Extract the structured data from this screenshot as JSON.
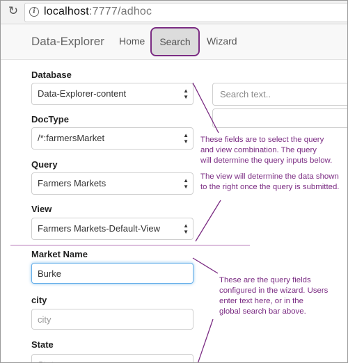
{
  "browser": {
    "url_host": "localhost",
    "url_rest": ":7777/adhoc"
  },
  "navbar": {
    "brand": "Data-Explorer",
    "links": [
      "Home",
      "Search",
      "Wizard"
    ],
    "active": "Search"
  },
  "form": {
    "database": {
      "label": "Database",
      "value": "Data-Explorer-content"
    },
    "doctype": {
      "label": "DocType",
      "value": "/*:farmersMarket"
    },
    "query": {
      "label": "Query",
      "value": "Farmers Markets"
    },
    "view": {
      "label": "View",
      "value": "Farmers Markets-Default-View"
    },
    "market_name": {
      "label": "Market Name",
      "value": "Burke"
    },
    "city": {
      "label": "city",
      "placeholder": "city"
    },
    "state": {
      "label": "State",
      "placeholder": "State"
    }
  },
  "search": {
    "placeholder": "Search text.."
  },
  "annotations": {
    "note1": [
      "These fields are to select the query",
      "and view combination. The query",
      "will determine the query inputs below.",
      "",
      "The view will determine the data shown",
      "to the right once the query is submitted."
    ],
    "note2": [
      "These are the query fields",
      "configured in the wizard. Users",
      "enter text here, or in the",
      "global search bar above."
    ]
  },
  "colors": {
    "annotation": "#7b2c83",
    "focus": "#66afe9"
  },
  "icons": {
    "reload": "reload-icon",
    "site_info": "info-icon",
    "select_caret": "updown-caret-icon"
  }
}
